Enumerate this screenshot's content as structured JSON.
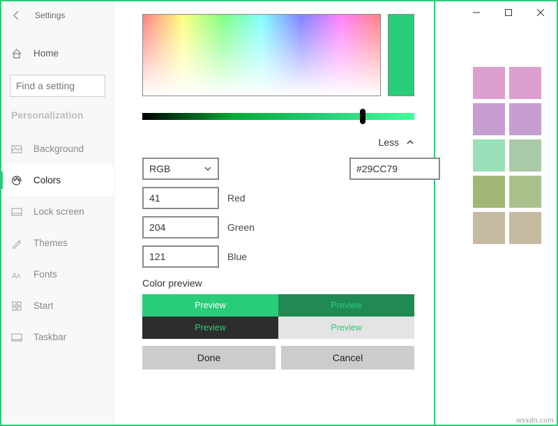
{
  "window": {
    "title": "Settings",
    "controls": {
      "minimize": "minimize-icon",
      "maximize": "maximize-icon",
      "close": "close-icon"
    }
  },
  "sidebar": {
    "back_label": "Settings",
    "home": "Home",
    "search_placeholder": "Find a setting",
    "heading": "Personalization",
    "items": [
      {
        "label": "Background",
        "selected": false
      },
      {
        "label": "Colors",
        "selected": true
      },
      {
        "label": "Lock screen",
        "selected": false
      },
      {
        "label": "Themes",
        "selected": false
      },
      {
        "label": "Fonts",
        "selected": false
      },
      {
        "label": "Start",
        "selected": false
      },
      {
        "label": "Taskbar",
        "selected": false
      }
    ]
  },
  "picker": {
    "less_label": "Less",
    "mode": "RGB",
    "hex": "#29CC79",
    "channels": {
      "r": "41",
      "r_label": "Red",
      "g": "204",
      "g_label": "Green",
      "b": "121",
      "b_label": "Blue"
    },
    "preview_title": "Color preview",
    "preview_label": "Preview",
    "done": "Done",
    "cancel": "Cancel",
    "sample_color": "#29CC79"
  },
  "recent_swatches": [
    "#dd9ed0",
    "#dd9ed0",
    "#c79ed0",
    "#c79ed0",
    "#99e0b8",
    "#a9caa7",
    "#a2b676",
    "#a9c08b",
    "#c6baa0",
    "#c6baa0"
  ],
  "watermark": "wsxdn.com"
}
